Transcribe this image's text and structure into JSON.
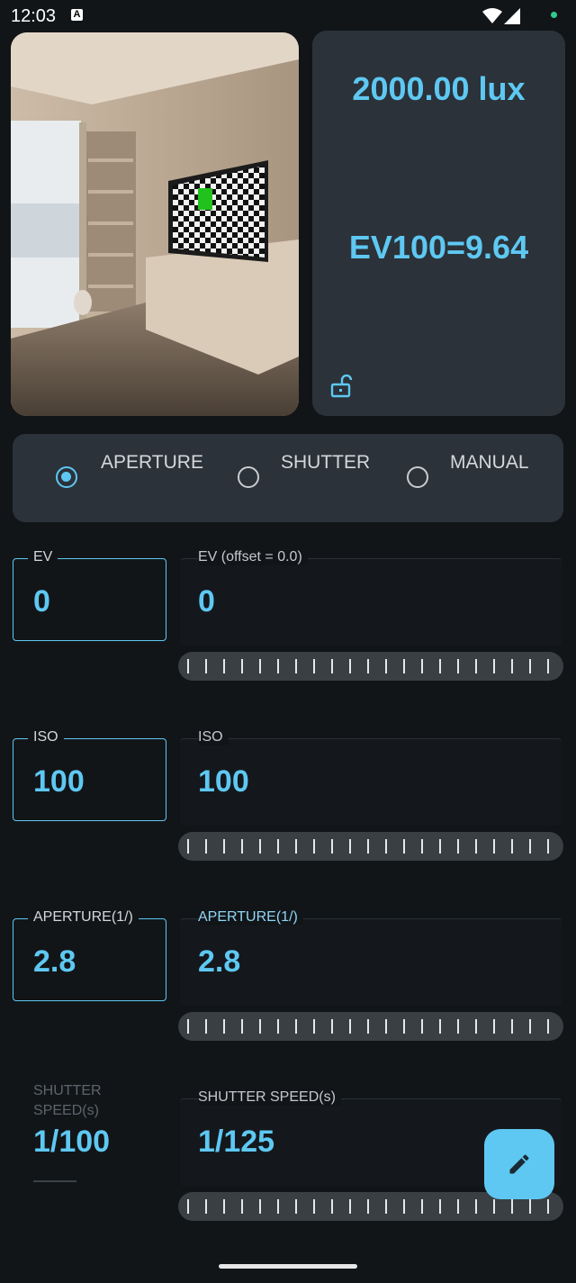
{
  "status_bar": {
    "time": "12:03",
    "notification_icon": "A",
    "icons": [
      "wifi-icon",
      "cell-signal-icon",
      "dot-icon"
    ]
  },
  "camera_preview": {
    "image": "room-with-tv-checkerboard"
  },
  "readout": {
    "lux": "2000.00 lux",
    "ev100": "EV100=9.64",
    "lock_icon": "unlock-icon"
  },
  "modes": {
    "options": [
      "APERTURE",
      "SHUTTER",
      "MANUAL"
    ],
    "selected": "APERTURE"
  },
  "rows": [
    {
      "field_label": "EV",
      "field_value": "0",
      "panel_label": "EV (offset = 0.0)",
      "panel_value": "0"
    },
    {
      "field_label": "ISO",
      "field_value": "100",
      "panel_label": "ISO",
      "panel_value": "100"
    },
    {
      "field_label": "APERTURE(1/)",
      "field_value": "2.8",
      "panel_label": "APERTURE(1/)",
      "panel_value": "2.8"
    },
    {
      "field_label": "SHUTTER SPEED(s)",
      "field_value": "1/100",
      "panel_label": "SHUTTER SPEED(s)",
      "panel_value": "1/125"
    }
  ],
  "fab": {
    "icon": "pencil-icon"
  },
  "colors": {
    "accent": "#5ec8f2",
    "card": "#2b3239",
    "background": "#121518"
  }
}
